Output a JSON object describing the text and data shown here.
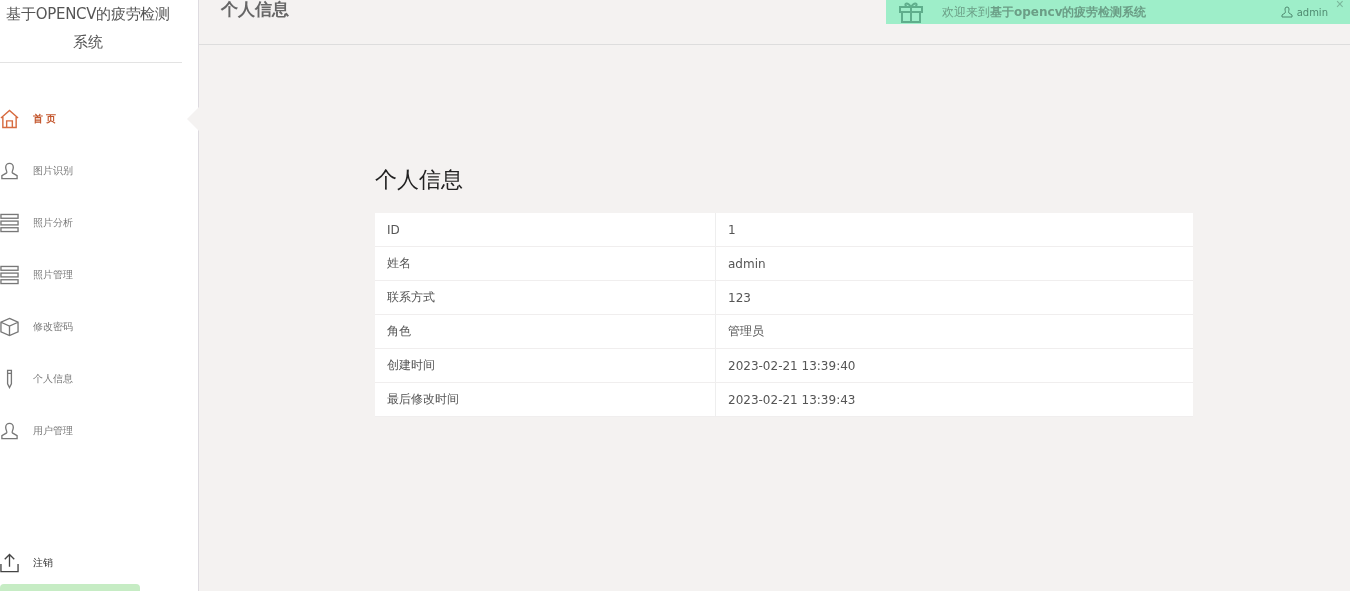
{
  "sidebar": {
    "title": "基于OPENCV的疲劳检测系统",
    "items": [
      {
        "label": "首 页",
        "selected": true
      },
      {
        "label": "图片识别",
        "selected": false
      },
      {
        "label": "照片分析",
        "selected": false
      },
      {
        "label": "照片管理",
        "selected": false
      },
      {
        "label": "修改密码",
        "selected": false
      },
      {
        "label": "个人信息",
        "selected": false
      },
      {
        "label": "用户管理",
        "selected": false
      }
    ],
    "logout": "注销"
  },
  "header": {
    "title": "个人信息"
  },
  "banner": {
    "text": "欢迎来到**基于opencv的疲劳检测系统**",
    "user": "admin",
    "close": "×"
  },
  "content": {
    "heading": "个人信息",
    "rows": [
      {
        "label": "ID",
        "value": "1"
      },
      {
        "label": "姓名",
        "value": "admin"
      },
      {
        "label": "联系方式",
        "value": "123"
      },
      {
        "label": "角色",
        "value": "管理员"
      },
      {
        "label": "创建时间",
        "value": "2023-02-21 13:39:40"
      },
      {
        "label": "最后修改时间",
        "value": "2023-02-21 13:39:43"
      }
    ]
  }
}
